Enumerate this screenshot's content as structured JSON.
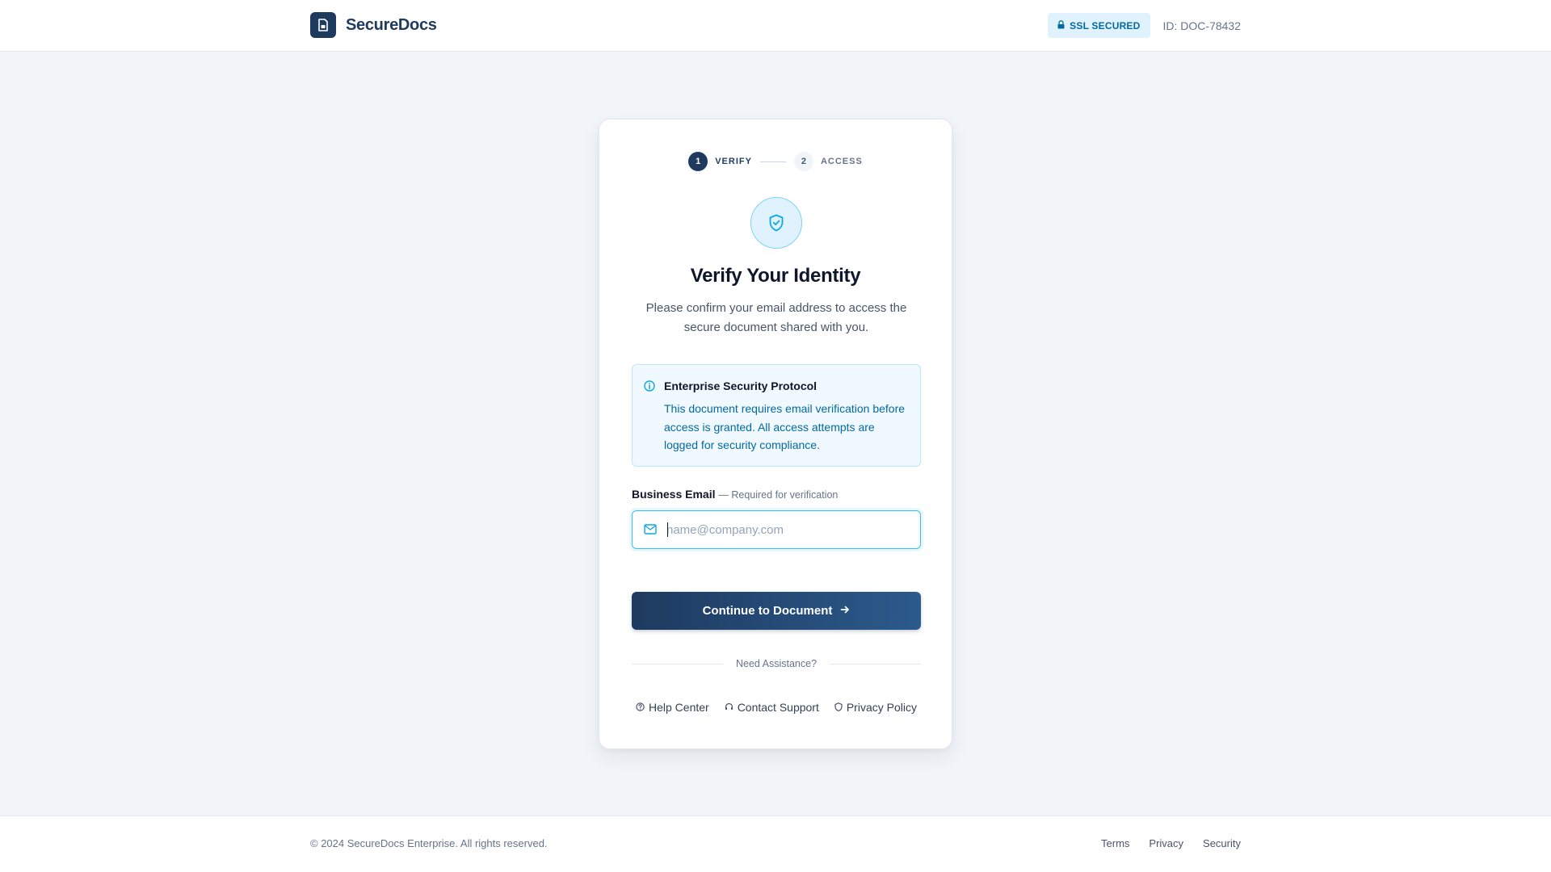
{
  "header": {
    "logo_icon": "file-lock-icon",
    "brand_name": "SecureDocs",
    "ssl_badge": {
      "icon": "lock-icon",
      "label": "SSL SECURED"
    },
    "doc_id": "ID: DOC-78432"
  },
  "stepper": {
    "steps": [
      {
        "number": "1",
        "label": "VERIFY",
        "state": "active"
      },
      {
        "number": "2",
        "label": "ACCESS",
        "state": "inactive"
      }
    ]
  },
  "verify": {
    "icon": "shield-icon",
    "title": "Verify Your Identity",
    "subtitle": "Please confirm your email address to access the secure document shared with you."
  },
  "notice": {
    "icon": "info-icon",
    "title": "Enterprise Security Protocol",
    "text": "This document requires email verification before access is granted. All access attempts are logged for security compliance."
  },
  "email_field": {
    "label": "Business Email",
    "hint": "— Required for verification",
    "icon": "mail-icon",
    "placeholder": "name@company.com",
    "value": ""
  },
  "continue_button": {
    "label": "Continue to Document",
    "icon": "arrow-right-icon"
  },
  "assistance": {
    "divider_text": "Need Assistance?",
    "links": [
      {
        "label": "Help Center",
        "icon": "help-icon"
      },
      {
        "label": "Contact Support",
        "icon": "headset-icon"
      },
      {
        "label": "Privacy Policy",
        "icon": "shield-icon"
      }
    ]
  },
  "footer": {
    "copyright": "© 2024 SecureDocs Enterprise. All rights reserved.",
    "links": [
      "Terms",
      "Privacy",
      "Security"
    ]
  },
  "colors": {
    "brand": "#1e3a5f",
    "accent": "#0ea5e9",
    "background": "#f1f5f9",
    "info_bg": "#f0f9ff"
  }
}
